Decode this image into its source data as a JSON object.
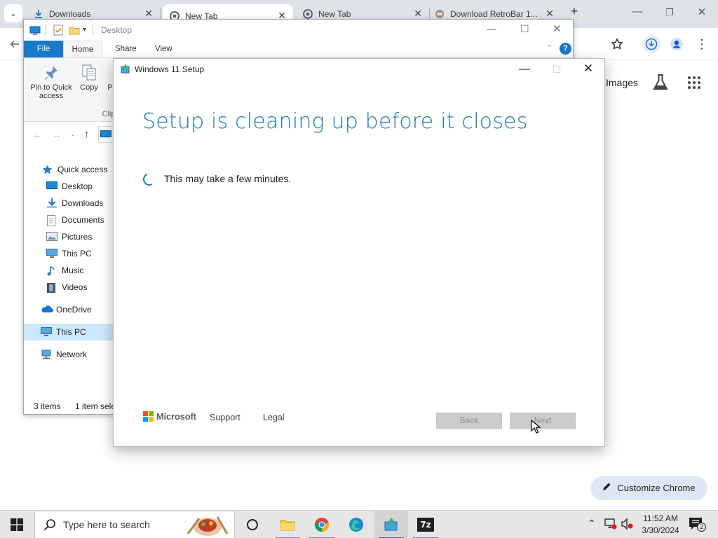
{
  "chrome": {
    "tabs": [
      {
        "title": "Downloads"
      },
      {
        "title": "New Tab"
      },
      {
        "title": "New Tab"
      },
      {
        "title": "Download RetroBar 1..."
      }
    ],
    "images_link": "Images",
    "customize_label": "Customize Chrome"
  },
  "explorer": {
    "title": "Desktop",
    "ribbon_tabs": {
      "file": "File",
      "home": "Home",
      "share": "Share",
      "view": "View"
    },
    "ribbon": {
      "pin_line1": "Pin to Quick",
      "pin_line2": "access",
      "copy": "Copy",
      "paste_partial": "P",
      "clipboard_partial": "Clip"
    },
    "nav": [
      {
        "label": "Quick access",
        "icon": "star-icon"
      },
      {
        "label": "Desktop",
        "icon": "desktop-icon"
      },
      {
        "label": "Downloads",
        "icon": "download-arrow-icon"
      },
      {
        "label": "Documents",
        "icon": "document-icon"
      },
      {
        "label": "Pictures",
        "icon": "pictures-icon"
      },
      {
        "label": "This PC",
        "icon": "computer-icon"
      },
      {
        "label": "Music",
        "icon": "music-note-icon"
      },
      {
        "label": "Videos",
        "icon": "film-icon"
      },
      {
        "label": "OneDrive",
        "icon": "cloud-icon"
      },
      {
        "label": "This PC",
        "icon": "computer-icon"
      },
      {
        "label": "Network",
        "icon": "network-icon"
      }
    ],
    "status": {
      "items": "3 items",
      "selected": "1 item sele"
    }
  },
  "setup": {
    "window_title": "Windows 11 Setup",
    "heading": "Setup is cleaning up before it closes",
    "message": "This may take a few minutes.",
    "brand": "Microsoft",
    "support": "Support",
    "legal": "Legal",
    "back": "Back",
    "next": "Next",
    "accent": "#1a78b5"
  },
  "taskbar": {
    "search_placeholder": "Type here to search",
    "time": "11:52 AM",
    "date": "3/30/2024",
    "notification_count": "2"
  }
}
